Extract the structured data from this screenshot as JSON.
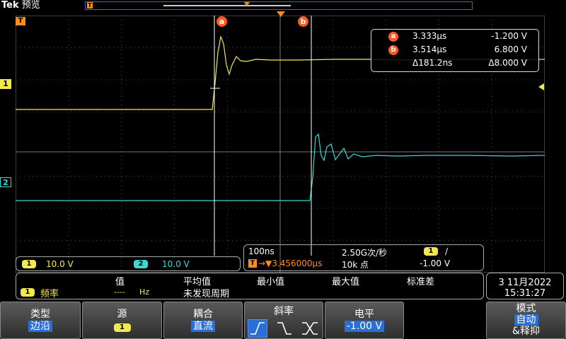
{
  "brand": {
    "logo": "Tek",
    "mode": "预览"
  },
  "markers": {
    "a": "a",
    "b": "b",
    "trigger": "T"
  },
  "channels": [
    {
      "id": "1",
      "color": "#f2e94e",
      "scale": "10.0 V"
    },
    {
      "id": "2",
      "color": "#3cd6d6",
      "scale": "10.0 V"
    }
  ],
  "cursor_readout": {
    "a": {
      "label": "a",
      "time": "3.333µs",
      "volt": "-1.200 V"
    },
    "b": {
      "label": "b",
      "time": "3.514µs",
      "volt": "6.800 V"
    },
    "delta": {
      "time": "Δ181.2ns",
      "volt": "Δ8.000 V"
    }
  },
  "timebase": {
    "scale": "100ns",
    "rate": "2.50G次/秒",
    "trig_ch": "1",
    "trig_slope": "/",
    "position": "→▼3.456000µs",
    "length": "10k 点",
    "trig_level": "-1.00 V"
  },
  "measurement": {
    "headers": [
      "值",
      "平均值",
      "最小值",
      "最大值",
      "标准差"
    ],
    "row": {
      "ch": "1",
      "name": "频率",
      "value": "----",
      "unit": "Hz",
      "status": "未发现周期"
    }
  },
  "clock": {
    "date": "3 11月2022",
    "time": "15:31:27"
  },
  "menu": {
    "type": {
      "title": "类型",
      "value": "边沿"
    },
    "source": {
      "title": "源",
      "value": "1"
    },
    "coupling": {
      "title": "耦合",
      "value": "直流"
    },
    "slope": {
      "title": "斜率"
    },
    "level": {
      "title": "电平",
      "value": "-1.00 V"
    },
    "mode": {
      "title": "模式",
      "value1": "自动",
      "value2": "&释抑"
    }
  },
  "colors": {
    "ch1": "#f2e94e",
    "ch2": "#3cd6d6",
    "cursor": "#ff5a1f",
    "trigger": "#ff8c1a",
    "grid": "#5a5a5a"
  }
}
